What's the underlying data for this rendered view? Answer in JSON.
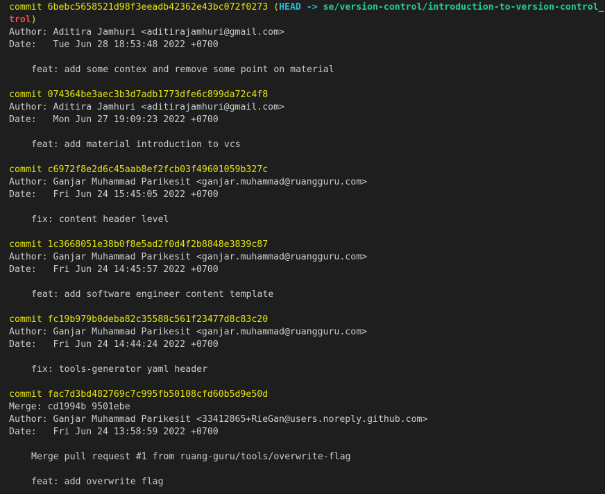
{
  "colors": {
    "background": "#1e1e1e",
    "foreground": "#cccccc",
    "commit_hash": "#e5e510",
    "head": "#29b8db",
    "branch": "#23d18b",
    "paren": "#e5e510",
    "wrapped_branch": "#f14c4c"
  },
  "head_ref": {
    "open_paren": "(",
    "head_label": "HEAD",
    "arrow": " -> ",
    "branch_name": "se/version-control/introduction-to-version-control_",
    "branch_wrap": "trol",
    "close_paren": ")"
  },
  "commits": [
    {
      "hash_line": "commit 6bebc5658521d98f3eeadb42362e43bc072f0273 ",
      "author_line": "Author: Aditira Jamhuri <aditirajamhuri@gmail.com>",
      "date_line": "Date:   Tue Jun 28 18:53:48 2022 +0700",
      "message": "feat: add some contex and remove some point on material"
    },
    {
      "hash_line": "commit 074364be3aec3b3d7adb1773dfe6c899da72c4f8",
      "author_line": "Author: Aditira Jamhuri <aditirajamhuri@gmail.com>",
      "date_line": "Date:   Mon Jun 27 19:09:23 2022 +0700",
      "message": "feat: add material introduction to vcs"
    },
    {
      "hash_line": "commit c6972f8e2d6c45aab8ef2fcb03f49601059b327c",
      "author_line": "Author: Ganjar Muhammad Parikesit <ganjar.muhammad@ruangguru.com>",
      "date_line": "Date:   Fri Jun 24 15:45:05 2022 +0700",
      "message": "fix: content header level"
    },
    {
      "hash_line": "commit 1c3668051e38b0f8e5ad2f0d4f2b8848e3839c87",
      "author_line": "Author: Ganjar Muhammad Parikesit <ganjar.muhammad@ruangguru.com>",
      "date_line": "Date:   Fri Jun 24 14:45:57 2022 +0700",
      "message": "feat: add software engineer content template"
    },
    {
      "hash_line": "commit fc19b979b0deba82c35588c561f23477d8c83c20",
      "author_line": "Author: Ganjar Muhammad Parikesit <ganjar.muhammad@ruangguru.com>",
      "date_line": "Date:   Fri Jun 24 14:44:24 2022 +0700",
      "message": "fix: tools-generator yaml header"
    },
    {
      "hash_line": "commit fac7d3bd482769c7c995fb50108cfd60b5d9e50d",
      "merge_line": "Merge: cd1994b 9501ebe",
      "author_line": "Author: Ganjar Muhammad Parikesit <33412865+RieGan@users.noreply.github.com>",
      "date_line": "Date:   Fri Jun 24 13:58:59 2022 +0700",
      "message": "Merge pull request #1 from ruang-guru/tools/overwrite-flag",
      "message2": "feat: add overwrite flag"
    }
  ]
}
